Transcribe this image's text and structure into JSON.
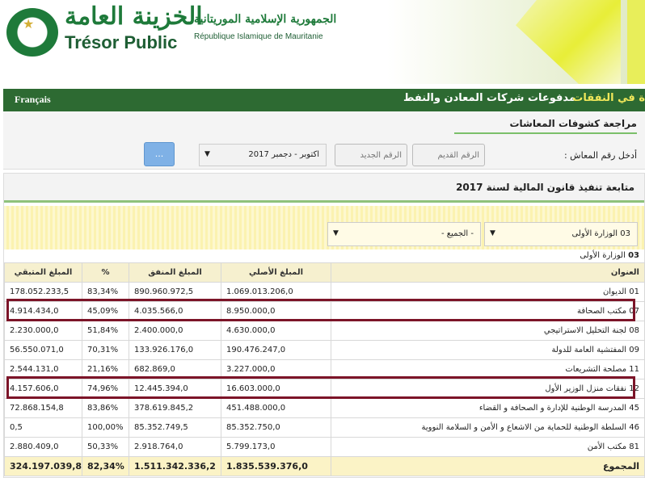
{
  "header": {
    "title_ar": "الخزينة العامة",
    "title_fr": "Trésor Public",
    "republic_ar": "الجمهورية الإسلامية الموريتانية",
    "republic_fr": "République Islamique de Mauritanie"
  },
  "nav": {
    "language": "Français",
    "item_expenses_partial": "ة في النفقات",
    "item_mining": "مدفوعات شركات المعادن والنفط"
  },
  "pension_search": {
    "title": "مراجعة كشوفات المعاشات",
    "label": "أدخل رقم المعاش :",
    "old_placeholder": "الرقم القديم",
    "new_placeholder": "الرقم الجديد",
    "period_value": "اكتوبر - دجمبر 2017",
    "button_label": "..."
  },
  "budget": {
    "title": "متابعة تنفيذ قانون المالية لسنة 2017",
    "ministry_select": "03 الوزارة الأولى",
    "all_select": "- الجميع -",
    "section_code": "03",
    "section_name": "الوزارة الأولى",
    "columns": [
      "العنوان",
      "المبلغ الأصلي",
      "المبلغ المنفق",
      "%",
      "المبلغ المتبقي"
    ],
    "rows": [
      {
        "title": "01 الديوان",
        "original": "1.069.013.206,0",
        "spent": "890.960.972,5",
        "pct": "83,34%",
        "remaining": "178.052.233,5"
      },
      {
        "title": "07 مكتب الصحافة",
        "original": "8.950.000,0",
        "spent": "4.035.566,0",
        "pct": "45,09%",
        "remaining": "4.914.434,0"
      },
      {
        "title": "08 لجنة التحليل الاستراتيجي",
        "original": "4.630.000,0",
        "spent": "2.400.000,0",
        "pct": "51,84%",
        "remaining": "2.230.000,0"
      },
      {
        "title": "09 المفتشية العامة للدولة",
        "original": "190.476.247,0",
        "spent": "133.926.176,0",
        "pct": "70,31%",
        "remaining": "56.550.071,0"
      },
      {
        "title": "11 مصلحة التشريعات",
        "original": "3.227.000,0",
        "spent": "682.869,0",
        "pct": "21,16%",
        "remaining": "2.544.131,0"
      },
      {
        "title": "12 نفقات منزل الوزير الأول",
        "original": "16.603.000,0",
        "spent": "12.445.394,0",
        "pct": "74,96%",
        "remaining": "4.157.606,0"
      },
      {
        "title": "45 المدرسة الوطنية للإدارة و الصحافة و القضاء",
        "original": "451.488.000,0",
        "spent": "378.619.845,2",
        "pct": "83,86%",
        "remaining": "72.868.154,8"
      },
      {
        "title": "46 السلطة الوطنية للحماية من الاشعاع و الأمن و السلامة النووية",
        "original": "85.352.750,0",
        "spent": "85.352.749,5",
        "pct": "100,00%",
        "remaining": "0,5"
      },
      {
        "title": "81 مكتب الأمن",
        "original": "5.799.173,0",
        "spent": "2.918.764,0",
        "pct": "50,33%",
        "remaining": "2.880.409,0"
      }
    ],
    "total": {
      "title": "المجموع",
      "original": "1.835.539.376,0",
      "spent": "1.511.342.336,2",
      "pct": "82,34%",
      "remaining": "324.197.039,8"
    }
  }
}
